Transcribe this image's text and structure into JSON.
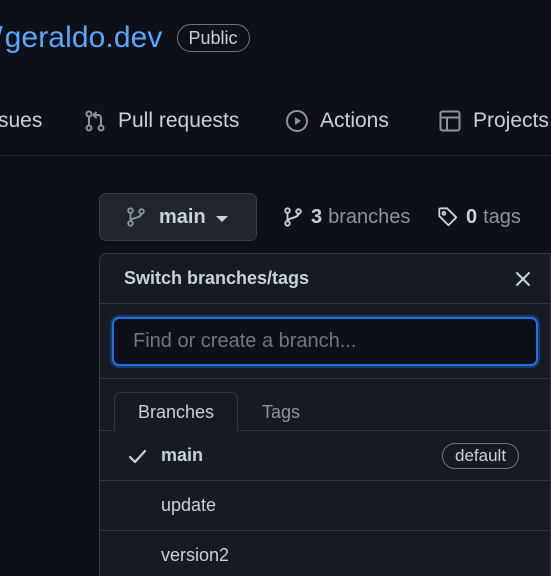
{
  "repo": {
    "separator": "/",
    "name": "geraldo.dev",
    "visibility": "Public"
  },
  "nav": {
    "issues_label": "sues",
    "pull_requests_label": "Pull requests",
    "actions_label": "Actions",
    "projects_label": "Projects"
  },
  "branch_button": {
    "current": "main"
  },
  "meta": {
    "branches_count": "3",
    "branches_label": "branches",
    "tags_count": "0",
    "tags_label": "tags"
  },
  "dropdown": {
    "title": "Switch branches/tags",
    "filter_placeholder": "Find or create a branch...",
    "tabs": [
      {
        "label": "Branches",
        "active": true
      },
      {
        "label": "Tags",
        "active": false
      }
    ],
    "items": [
      {
        "name": "main",
        "selected": true,
        "badge": "default"
      },
      {
        "name": "update",
        "selected": false,
        "badge": ""
      },
      {
        "name": "version2",
        "selected": false,
        "badge": ""
      }
    ]
  },
  "colors": {
    "background": "#0d1117",
    "link": "#58a6ff",
    "text": "#c9d1d9",
    "muted": "#8b949e",
    "focus": "#1f6feb"
  }
}
